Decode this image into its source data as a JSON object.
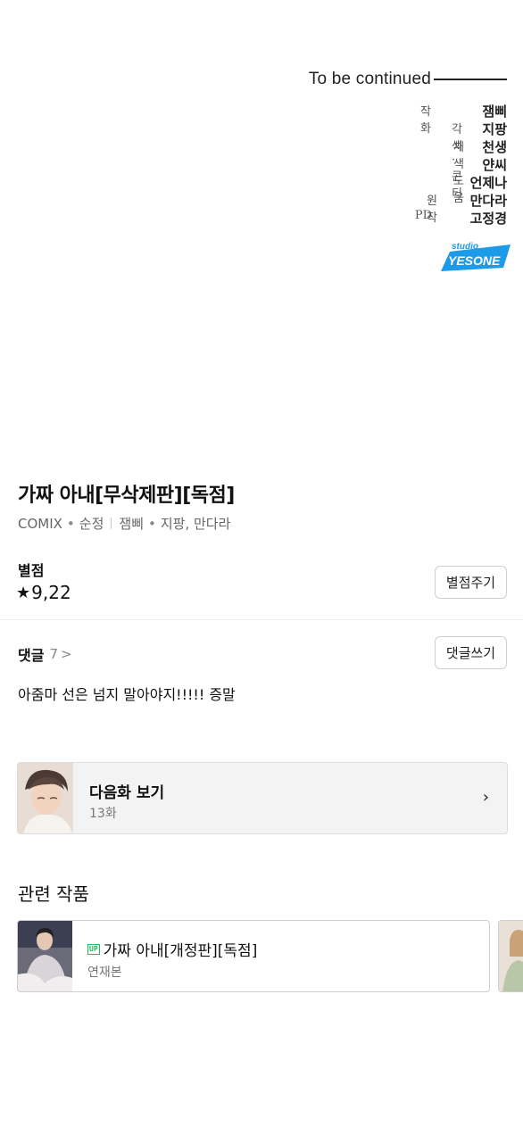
{
  "comic_end": {
    "continued_text": "To be continued",
    "credits": [
      {
        "role": "작화",
        "names": [
          "잼삐"
        ]
      },
      {
        "role": "각색·콘티",
        "names": [
          "지팡"
        ]
      },
      {
        "role": "채색 도움",
        "names": [
          "천생",
          "얀씨",
          "언제나"
        ]
      },
      {
        "role": "원작",
        "names": [
          "만다라"
        ]
      },
      {
        "role": "PD",
        "names": [
          "고정경"
        ]
      }
    ],
    "studio_logo": {
      "line1": "studio",
      "line2": "YESONE",
      "color": "#1e9be8"
    }
  },
  "work": {
    "title": "가짜 아내[무삭제판][독점]",
    "platform": "COMIX",
    "genre": "순정",
    "authors": "잼삐",
    "authors2": "지팡, 만다라"
  },
  "rating": {
    "label": "별점",
    "star": "★",
    "value": "9,22",
    "button": "별점주기"
  },
  "comments": {
    "label": "댓글",
    "count": "7",
    "chevron": ">",
    "button": "댓글쓰기",
    "top_comment": "아줌마 선은 넘지 말아야지!!!!! 증말"
  },
  "next_episode": {
    "title": "다음화 보기",
    "episode": "13화",
    "chevron": "›"
  },
  "related": {
    "heading": "관련 작품",
    "items": [
      {
        "badge": "UP",
        "title": "가짜 아내[개정판][독점]",
        "status": "연재본"
      }
    ]
  }
}
